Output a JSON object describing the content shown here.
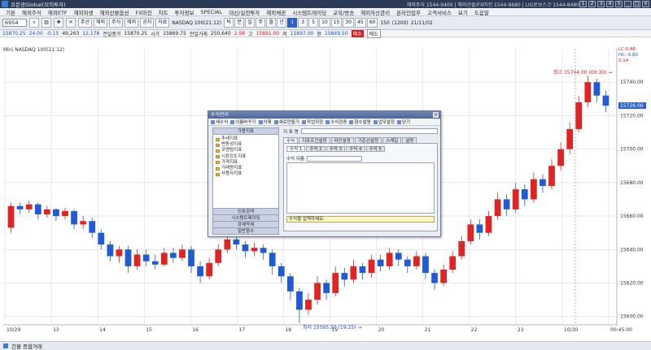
{
  "app": {
    "title": "코몬광Global(모의투자)",
    "contact": "해외주식 1544-9400 | 해외선물/FX마진 1544-9680 | LIG로보스크 1544-8480"
  },
  "window_buttons": [
    "1",
    "2",
    "3",
    "4",
    "5",
    "_",
    "□",
    "×"
  ],
  "menu": [
    "기본",
    "해외주식",
    "해외ETF",
    "해외파생",
    "해외선물옵션",
    "FX마진",
    "차트",
    "투자정보",
    "SPECIAL",
    "대신/실전투자",
    "해외채권",
    "시스템트레이딩",
    "교육/방송",
    "해외자산관리",
    "온라인업무",
    "고객서비스",
    "보기",
    "도움말"
  ],
  "toolbar": {
    "code": "6954",
    "buttons": [
      "주선",
      "해외",
      "주식",
      "해외",
      "공지",
      "자료"
    ],
    "symbol": "NASDAQ 100(21.12)",
    "intervals": [
      "틱",
      "분",
      "일",
      "주",
      "월",
      "년",
      "1",
      "3",
      "5",
      "10",
      "15",
      "30",
      "45",
      "60"
    ],
    "active_interval": "1",
    "count": "150",
    "total": "(1200)",
    "date": "21/11/02"
  },
  "quote": {
    "price": "15870.25",
    "change": "24.00",
    "pct": "-0.15",
    "volume": "49,263",
    "sub": "12,178",
    "prev_label": "전일종가",
    "prev": "15870.25",
    "open_label": "시가",
    "open": "15869.75",
    "vol2_label": "전일거래",
    "vol2": "250,640",
    "vol2pct": "2.98",
    "high_label": "고",
    "high": "15891.00",
    "low_label": "저",
    "low": "15897.00",
    "last_label": "현",
    "last": "15849.50",
    "tag1": "매수",
    "tag2": "매도"
  },
  "chart_label": "Mini NASDAQ 100(21.12)",
  "chart_data": {
    "type": "candlestick",
    "title": "Mini NASDAQ 100(21.12)",
    "ylim": [
      15595,
      15760
    ],
    "y_ticks": [
      15740.0,
      15720.0,
      15700.0,
      15680.0,
      15660.0,
      15640.0,
      15620.0,
      15600.0
    ],
    "x_ticks": [
      "10/29",
      "13",
      "14",
      "15",
      "16",
      "17",
      "18",
      "19",
      "20",
      "21",
      "22",
      "23",
      "10/30",
      "00:45:00"
    ],
    "annotations": {
      "high": {
        "text": "최고 15744.00 (00:30)",
        "value": 15744.0
      },
      "low": {
        "text": "최저 15595.50 (19:25)",
        "value": 15595.5
      },
      "current": {
        "text": "15726.00",
        "value": 15726.0
      },
      "side_labels": [
        "LC:0.86",
        "HC:-0.80",
        "0.14"
      ]
    },
    "candles": [
      {
        "o": 15653,
        "c": 15666,
        "h": 15668,
        "l": 15650
      },
      {
        "o": 15666,
        "c": 15664,
        "h": 15668,
        "l": 15661
      },
      {
        "o": 15664,
        "c": 15667,
        "h": 15669,
        "l": 15662
      },
      {
        "o": 15667,
        "c": 15661,
        "h": 15668,
        "l": 15658
      },
      {
        "o": 15661,
        "c": 15664,
        "h": 15666,
        "l": 15659
      },
      {
        "o": 15664,
        "c": 15660,
        "h": 15665,
        "l": 15657
      },
      {
        "o": 15660,
        "c": 15663,
        "h": 15665,
        "l": 15658
      },
      {
        "o": 15663,
        "c": 15655,
        "h": 15664,
        "l": 15652
      },
      {
        "o": 15655,
        "c": 15657,
        "h": 15660,
        "l": 15652
      },
      {
        "o": 15657,
        "c": 15650,
        "h": 15659,
        "l": 15647
      },
      {
        "o": 15650,
        "c": 15643,
        "h": 15652,
        "l": 15640
      },
      {
        "o": 15643,
        "c": 15636,
        "h": 15645,
        "l": 15633
      },
      {
        "o": 15636,
        "c": 15640,
        "h": 15642,
        "l": 15632
      },
      {
        "o": 15640,
        "c": 15630,
        "h": 15642,
        "l": 15626
      },
      {
        "o": 15630,
        "c": 15637,
        "h": 15640,
        "l": 15628
      },
      {
        "o": 15637,
        "c": 15633,
        "h": 15640,
        "l": 15630
      },
      {
        "o": 15633,
        "c": 15631,
        "h": 15637,
        "l": 15628
      },
      {
        "o": 15631,
        "c": 15638,
        "h": 15641,
        "l": 15630
      },
      {
        "o": 15638,
        "c": 15635,
        "h": 15641,
        "l": 15632
      },
      {
        "o": 15635,
        "c": 15640,
        "h": 15643,
        "l": 15633
      },
      {
        "o": 15640,
        "c": 15630,
        "h": 15642,
        "l": 15626
      },
      {
        "o": 15630,
        "c": 15624,
        "h": 15633,
        "l": 15620
      },
      {
        "o": 15624,
        "c": 15632,
        "h": 15635,
        "l": 15622
      },
      {
        "o": 15632,
        "c": 15640,
        "h": 15643,
        "l": 15630
      },
      {
        "o": 15640,
        "c": 15646,
        "h": 15650,
        "l": 15638
      },
      {
        "o": 15646,
        "c": 15643,
        "h": 15648,
        "l": 15640
      },
      {
        "o": 15643,
        "c": 15639,
        "h": 15645,
        "l": 15635
      },
      {
        "o": 15639,
        "c": 15641,
        "h": 15644,
        "l": 15636
      },
      {
        "o": 15641,
        "c": 15638,
        "h": 15643,
        "l": 15634
      },
      {
        "o": 15638,
        "c": 15630,
        "h": 15640,
        "l": 15625
      },
      {
        "o": 15630,
        "c": 15624,
        "h": 15632,
        "l": 15620
      },
      {
        "o": 15624,
        "c": 15615,
        "h": 15626,
        "l": 15610
      },
      {
        "o": 15615,
        "c": 15604,
        "h": 15617,
        "l": 15596
      },
      {
        "o": 15604,
        "c": 15610,
        "h": 15614,
        "l": 15601
      },
      {
        "o": 15610,
        "c": 15620,
        "h": 15624,
        "l": 15607
      },
      {
        "o": 15620,
        "c": 15614,
        "h": 15622,
        "l": 15610
      },
      {
        "o": 15614,
        "c": 15626,
        "h": 15630,
        "l": 15612
      },
      {
        "o": 15626,
        "c": 15622,
        "h": 15629,
        "l": 15618
      },
      {
        "o": 15622,
        "c": 15630,
        "h": 15634,
        "l": 15620
      },
      {
        "o": 15630,
        "c": 15626,
        "h": 15632,
        "l": 15622
      },
      {
        "o": 15626,
        "c": 15634,
        "h": 15637,
        "l": 15623
      },
      {
        "o": 15634,
        "c": 15630,
        "h": 15637,
        "l": 15627
      },
      {
        "o": 15630,
        "c": 15638,
        "h": 15641,
        "l": 15628
      },
      {
        "o": 15638,
        "c": 15634,
        "h": 15640,
        "l": 15630
      },
      {
        "o": 15634,
        "c": 15630,
        "h": 15636,
        "l": 15626
      },
      {
        "o": 15630,
        "c": 15636,
        "h": 15639,
        "l": 15628
      },
      {
        "o": 15636,
        "c": 15626,
        "h": 15638,
        "l": 15622
      },
      {
        "o": 15626,
        "c": 15620,
        "h": 15628,
        "l": 15616
      },
      {
        "o": 15620,
        "c": 15628,
        "h": 15631,
        "l": 15618
      },
      {
        "o": 15628,
        "c": 15636,
        "h": 15639,
        "l": 15626
      },
      {
        "o": 15636,
        "c": 15645,
        "h": 15648,
        "l": 15634
      },
      {
        "o": 15645,
        "c": 15655,
        "h": 15658,
        "l": 15643
      },
      {
        "o": 15655,
        "c": 15650,
        "h": 15658,
        "l": 15646
      },
      {
        "o": 15650,
        "c": 15660,
        "h": 15663,
        "l": 15648
      },
      {
        "o": 15660,
        "c": 15670,
        "h": 15674,
        "l": 15658
      },
      {
        "o": 15670,
        "c": 15664,
        "h": 15673,
        "l": 15660
      },
      {
        "o": 15664,
        "c": 15676,
        "h": 15680,
        "l": 15662
      },
      {
        "o": 15676,
        "c": 15670,
        "h": 15679,
        "l": 15666
      },
      {
        "o": 15670,
        "c": 15682,
        "h": 15686,
        "l": 15668
      },
      {
        "o": 15682,
        "c": 15678,
        "h": 15685,
        "l": 15674
      },
      {
        "o": 15678,
        "c": 15690,
        "h": 15694,
        "l": 15676
      },
      {
        "o": 15690,
        "c": 15700,
        "h": 15704,
        "l": 15687
      },
      {
        "o": 15700,
        "c": 15712,
        "h": 15716,
        "l": 15697
      },
      {
        "o": 15712,
        "c": 15728,
        "h": 15732,
        "l": 15710
      },
      {
        "o": 15728,
        "c": 15740,
        "h": 15744,
        "l": 15725
      },
      {
        "o": 15740,
        "c": 15732,
        "h": 15742,
        "l": 15728
      },
      {
        "o": 15732,
        "c": 15726,
        "h": 15735,
        "l": 15722
      }
    ]
  },
  "dialog": {
    "title": "수식관리",
    "toolbar": [
      "새수식",
      "이름바꾸기",
      "삭제",
      "새로만들기",
      "작업저장",
      "수식검증",
      "함수설명",
      "업무설정",
      "닫기"
    ],
    "left_header": "가용지표",
    "tree": [
      "추세지표",
      "변동성지표",
      "모멘텀지표",
      "시장강도지표",
      "가격지표",
      "거래량지표",
      "사용자지표"
    ],
    "left_buttons": [
      "신호검색",
      "시스템트레이딩",
      "강세약세",
      "일반함수"
    ],
    "name_label": "지 표 명",
    "tabs": [
      "수식",
      "지표조건설정",
      "라인설정",
      "기준선설정",
      "스케일",
      "설명"
    ],
    "subtabs": [
      "수식 1",
      "수식 2",
      "수식 3",
      "수식 4",
      "수식 5"
    ],
    "formula_label": "수식 이름",
    "hint": "수식을 입력하세요."
  },
  "status": {
    "label": "건물 종합거래"
  }
}
